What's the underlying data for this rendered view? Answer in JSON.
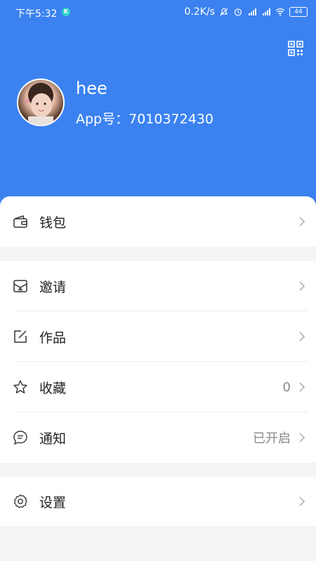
{
  "status_bar": {
    "time": "下午5:32",
    "k_badge": "K",
    "network_speed": "0.2K/s",
    "battery": "44"
  },
  "profile": {
    "username": "hee",
    "app_id": "App号：7010372430"
  },
  "menu": {
    "wallet": {
      "label": "钱包"
    },
    "invite": {
      "label": "邀请"
    },
    "works": {
      "label": "作品"
    },
    "favorites": {
      "label": "收藏",
      "value": "0"
    },
    "notifications": {
      "label": "通知",
      "value": "已开启"
    },
    "settings": {
      "label": "设置"
    }
  },
  "colors": {
    "header": "#3b82f0",
    "background": "#f4f4f4"
  }
}
